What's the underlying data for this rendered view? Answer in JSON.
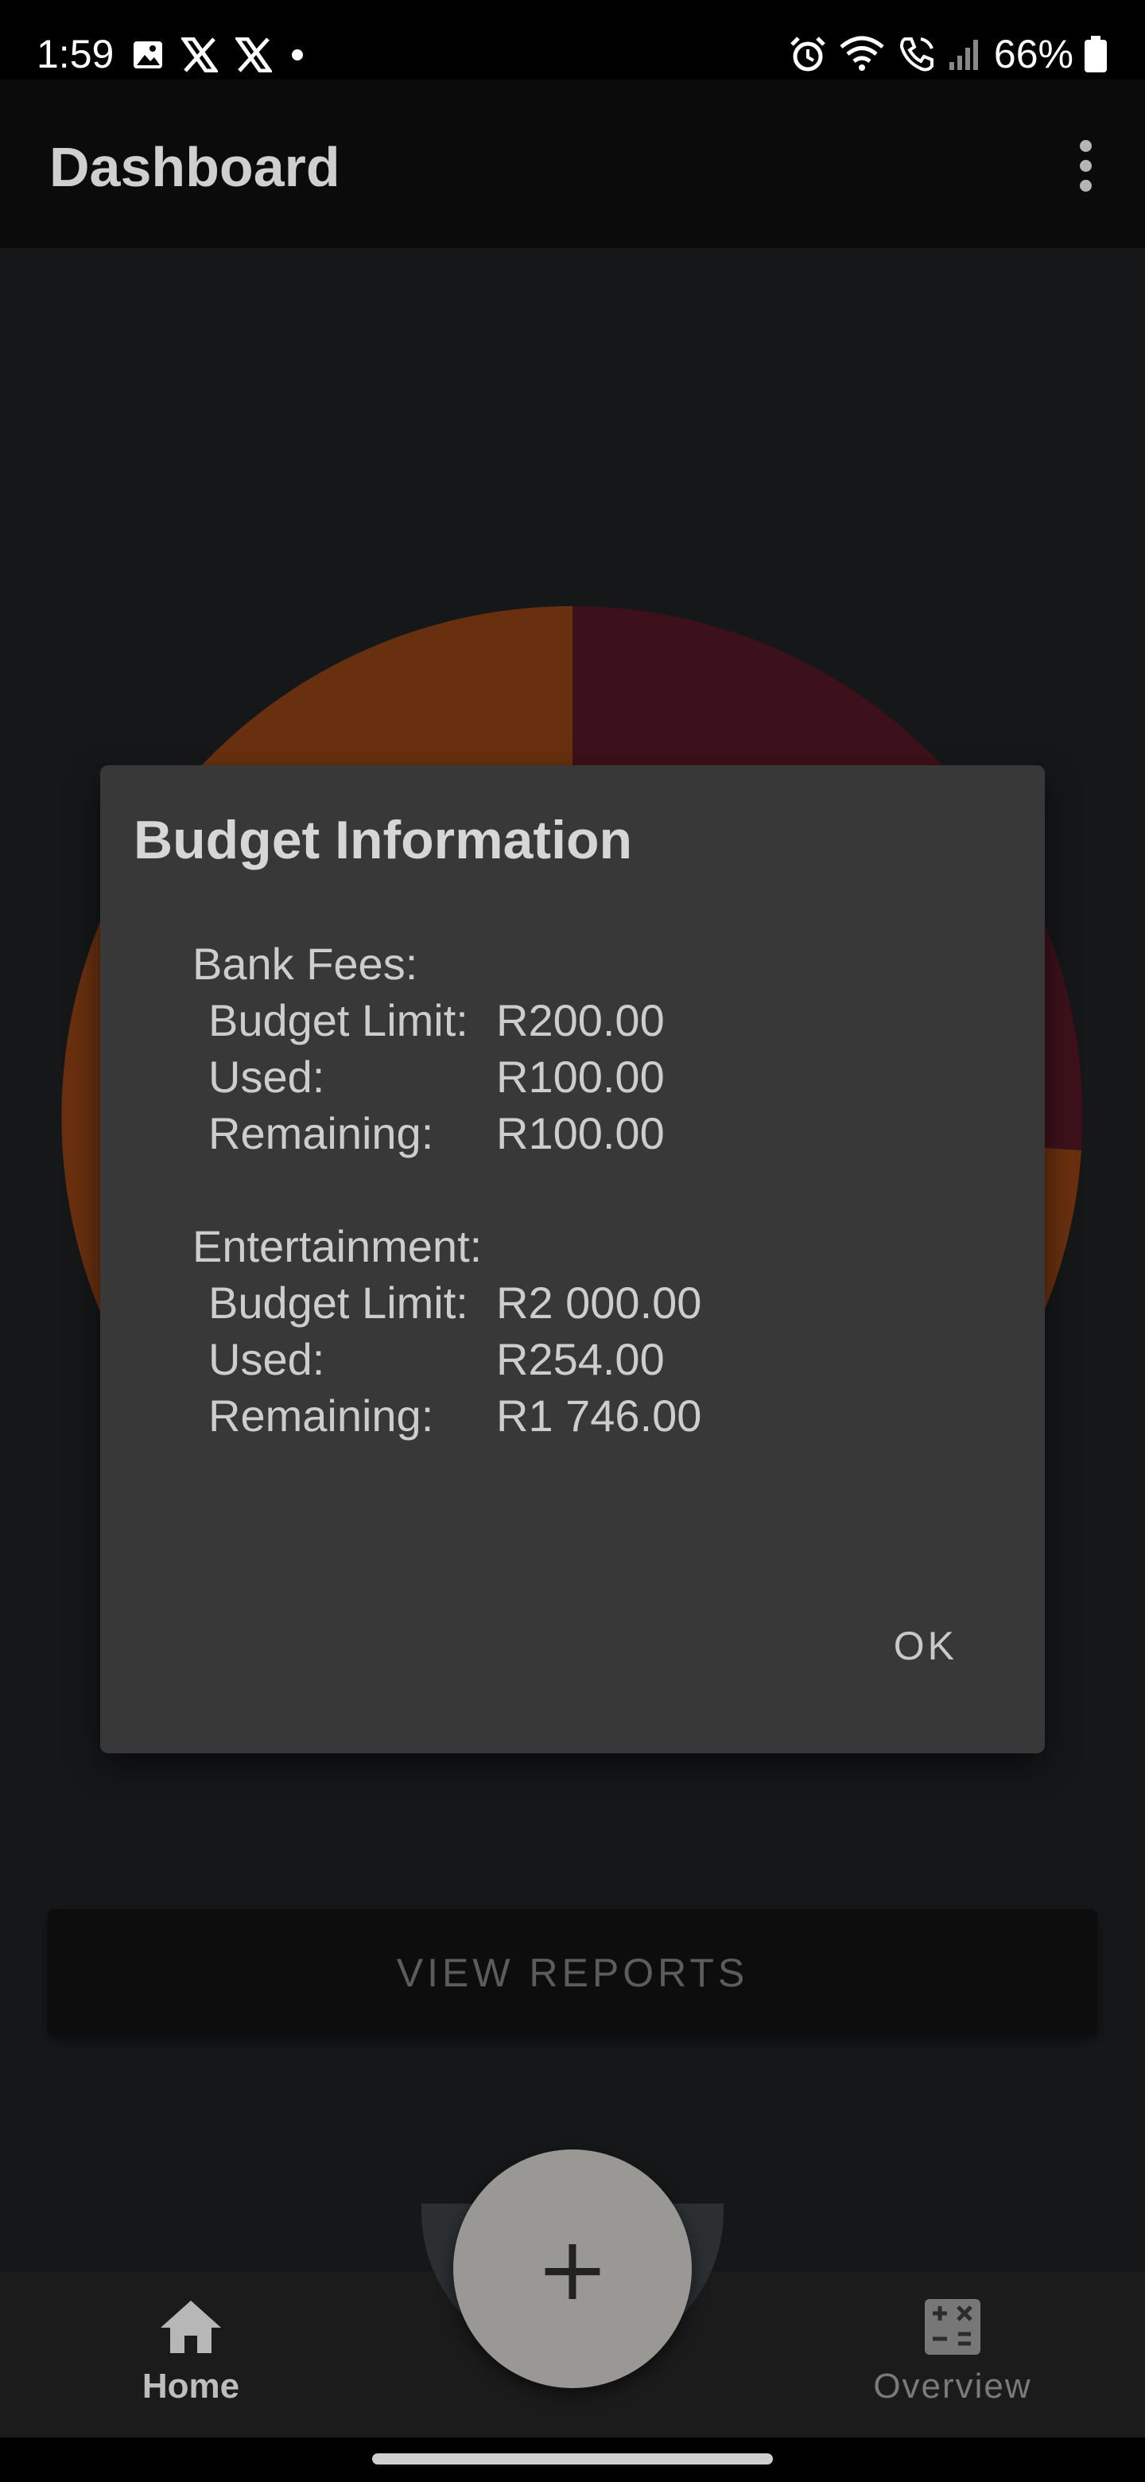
{
  "status_bar": {
    "time": "1:59",
    "battery": "66%",
    "left_icons": [
      "image-icon",
      "x-logo-icon",
      "x-logo-icon",
      "dot-icon"
    ],
    "right_icons": [
      "alarm-icon",
      "wifi-calling-icon",
      "call-icon",
      "signal-icon",
      "battery-icon"
    ]
  },
  "app_bar": {
    "title": "Dashboard"
  },
  "chart_data": {
    "type": "pie",
    "colors": [
      "#7b2337",
      "#d2611f",
      "#a24f1f"
    ]
  },
  "dialog": {
    "title": "Budget Information",
    "sections": [
      {
        "heading": "Bank Fees:",
        "rows": [
          {
            "label": "Budget Limit:",
            "value": "R200.00"
          },
          {
            "label": "Used:",
            "value": "R100.00"
          },
          {
            "label": "Remaining:",
            "value": "R100.00"
          }
        ]
      },
      {
        "heading": "Entertainment:",
        "rows": [
          {
            "label": "Budget Limit:",
            "value": "R2 000.00"
          },
          {
            "label": "Used:",
            "value": "R254.00"
          },
          {
            "label": "Remaining:",
            "value": "R1 746.00"
          }
        ]
      }
    ],
    "ok_label": "OK"
  },
  "main": {
    "view_reports_label": "VIEW REPORTS"
  },
  "fab": {
    "label": "+"
  },
  "bottom_nav": {
    "items": [
      {
        "label": "Home",
        "icon": "home-icon"
      },
      {
        "label": "Overview",
        "icon": "calculator-icon"
      }
    ]
  }
}
